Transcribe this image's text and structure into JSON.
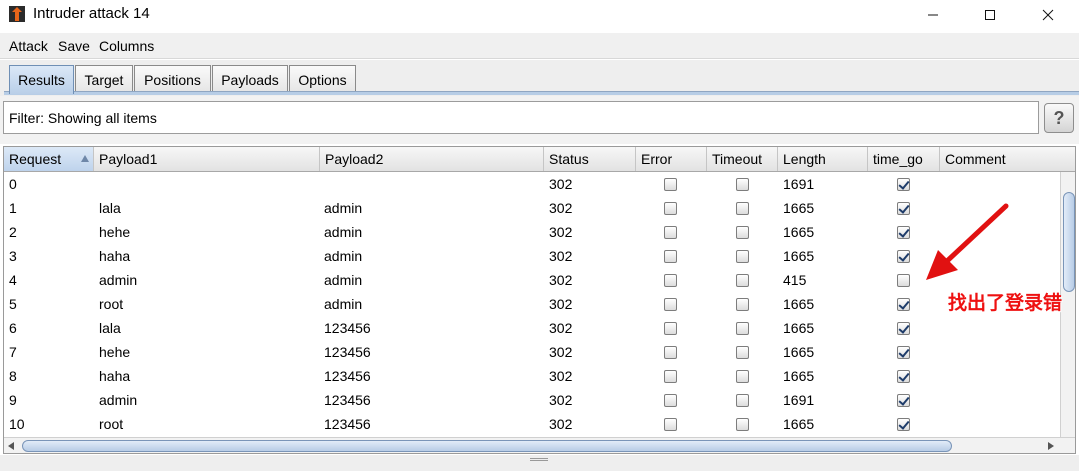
{
  "window": {
    "title": "Intruder attack 14",
    "controls": [
      "minimize",
      "maximize",
      "close"
    ]
  },
  "menu": [
    "Attack",
    "Save",
    "Columns"
  ],
  "tabs": [
    {
      "label": "Results",
      "active": true
    },
    {
      "label": "Target",
      "active": false
    },
    {
      "label": "Positions",
      "active": false
    },
    {
      "label": "Payloads",
      "active": false
    },
    {
      "label": "Options",
      "active": false
    }
  ],
  "filter": {
    "text": "Filter: Showing all items",
    "help_label": "?"
  },
  "table": {
    "columns": [
      "Request",
      "Payload1",
      "Payload2",
      "Status",
      "Error",
      "Timeout",
      "Length",
      "time_go",
      "Comment"
    ],
    "sorted_column": "Request",
    "rows": [
      {
        "request": "0",
        "payload1": "",
        "payload2": "",
        "status": "302",
        "error": false,
        "timeout": false,
        "length": "1691",
        "time_go": true,
        "comment": ""
      },
      {
        "request": "1",
        "payload1": "lala",
        "payload2": "admin",
        "status": "302",
        "error": false,
        "timeout": false,
        "length": "1665",
        "time_go": true,
        "comment": ""
      },
      {
        "request": "2",
        "payload1": "hehe",
        "payload2": "admin",
        "status": "302",
        "error": false,
        "timeout": false,
        "length": "1665",
        "time_go": true,
        "comment": ""
      },
      {
        "request": "3",
        "payload1": "haha",
        "payload2": "admin",
        "status": "302",
        "error": false,
        "timeout": false,
        "length": "1665",
        "time_go": true,
        "comment": ""
      },
      {
        "request": "4",
        "payload1": "admin",
        "payload2": "admin",
        "status": "302",
        "error": false,
        "timeout": false,
        "length": "415",
        "time_go": false,
        "comment": ""
      },
      {
        "request": "5",
        "payload1": "root",
        "payload2": "admin",
        "status": "302",
        "error": false,
        "timeout": false,
        "length": "1665",
        "time_go": true,
        "comment": ""
      },
      {
        "request": "6",
        "payload1": "lala",
        "payload2": "123456",
        "status": "302",
        "error": false,
        "timeout": false,
        "length": "1665",
        "time_go": true,
        "comment": ""
      },
      {
        "request": "7",
        "payload1": "hehe",
        "payload2": "123456",
        "status": "302",
        "error": false,
        "timeout": false,
        "length": "1665",
        "time_go": true,
        "comment": ""
      },
      {
        "request": "8",
        "payload1": "haha",
        "payload2": "123456",
        "status": "302",
        "error": false,
        "timeout": false,
        "length": "1665",
        "time_go": true,
        "comment": ""
      },
      {
        "request": "9",
        "payload1": "admin",
        "payload2": "123456",
        "status": "302",
        "error": false,
        "timeout": false,
        "length": "1691",
        "time_go": true,
        "comment": ""
      },
      {
        "request": "10",
        "payload1": "root",
        "payload2": "123456",
        "status": "302",
        "error": false,
        "timeout": false,
        "length": "1665",
        "time_go": true,
        "comment": ""
      }
    ]
  },
  "annotation": {
    "text": "找出了登录错",
    "color": "#e11111"
  },
  "colors": {
    "active_tab": "#b9cfe8",
    "annotation": "#e11111",
    "app_icon": "#e8651a"
  }
}
